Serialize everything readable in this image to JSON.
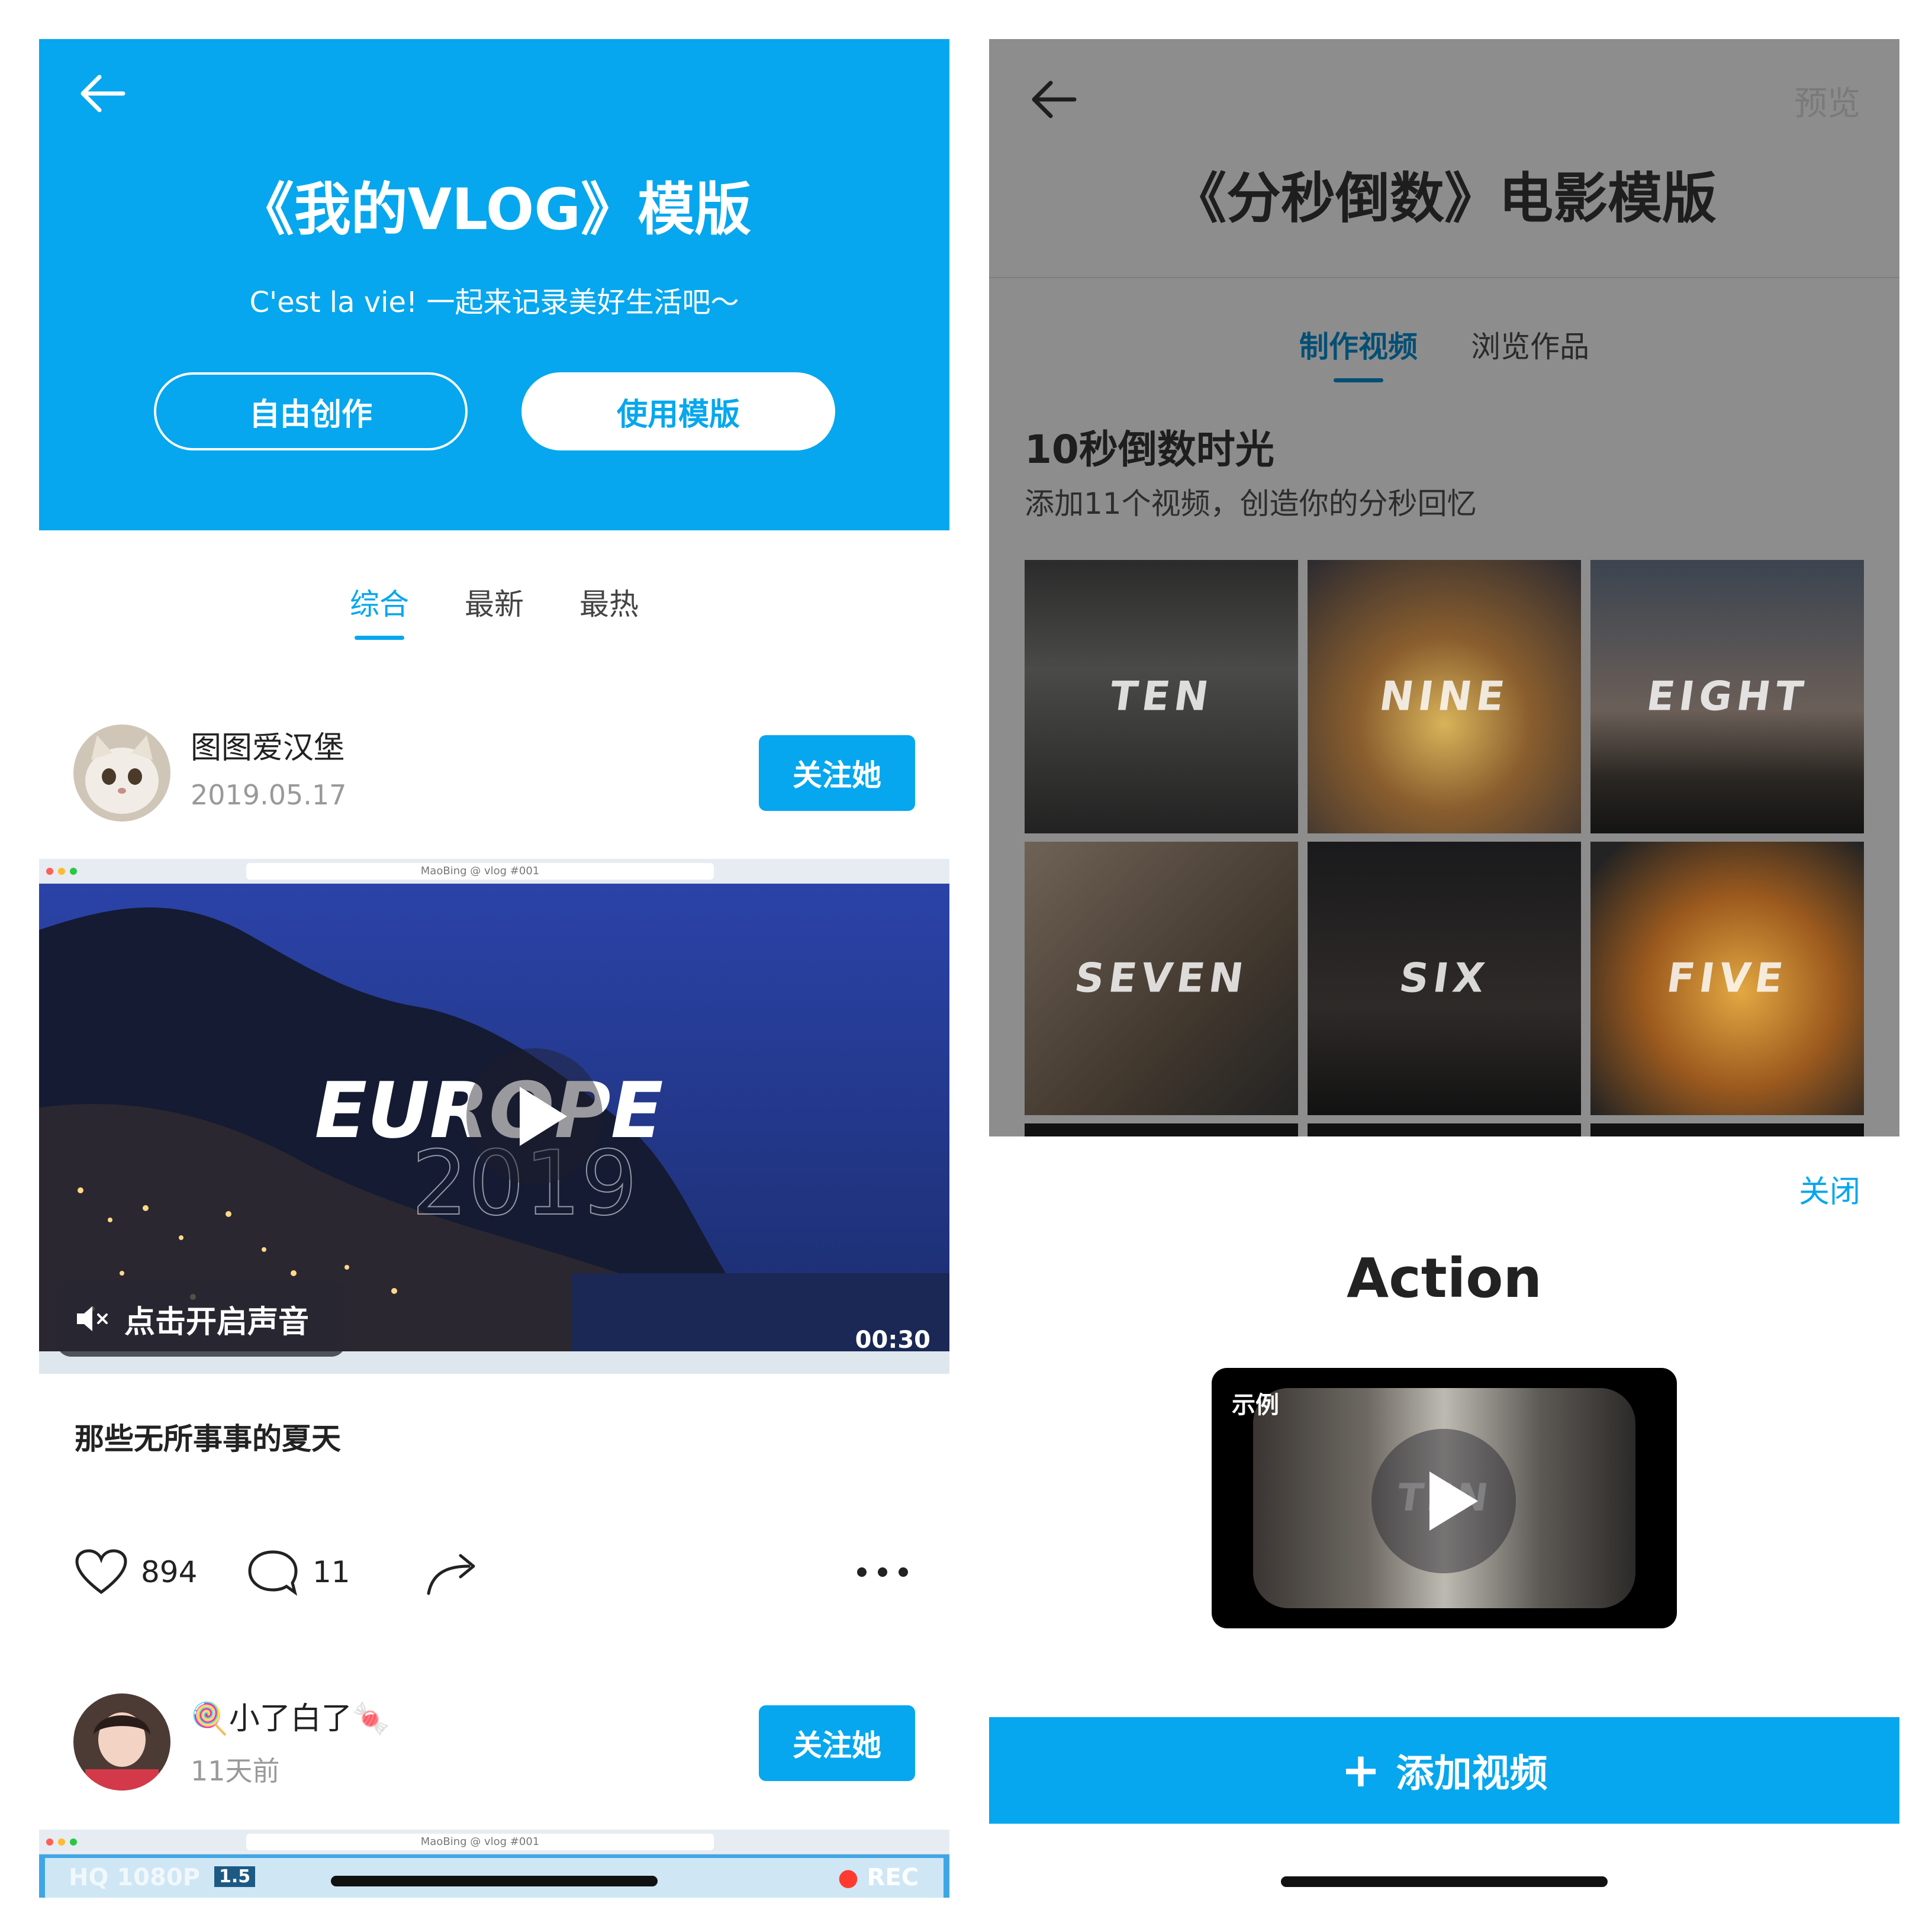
{
  "left": {
    "header": {
      "title": "《我的VLOG》模版",
      "subtitle": "C'est la vie! 一起来记录美好生活吧～",
      "buttons": {
        "free_create": "自由创作",
        "use_template": "使用模版"
      }
    },
    "tabs": [
      {
        "label": "综合",
        "active": true
      },
      {
        "label": "最新",
        "active": false
      },
      {
        "label": "最热",
        "active": false
      }
    ],
    "posts": [
      {
        "user": "图图爱汉堡",
        "time": "2019.05.17",
        "follow_label": "关注她",
        "video": {
          "browser_title": "MaoBing @ vlog #001",
          "overlay_title": "EUROPE",
          "overlay_year": "2019",
          "sound_hint": "点击开启声音",
          "duration": "00:30"
        },
        "caption": "那些无所事事的夏天",
        "likes": "894",
        "comments": "11"
      },
      {
        "user": "🍭小了白了🍬",
        "time": "11天前",
        "follow_label": "关注她",
        "video": {
          "browser_title": "MaoBing @ vlog #001",
          "hq_label": "HQ 1080P",
          "zoom_label": "1.5",
          "rec_label": "REC"
        }
      }
    ]
  },
  "right": {
    "header": {
      "title": "《分秒倒数》电影模版",
      "preview": "预览"
    },
    "tabs": [
      {
        "label": "制作视频",
        "active": true
      },
      {
        "label": "浏览作品",
        "active": false
      }
    ],
    "section": {
      "title": "10秒倒数时光",
      "desc": "添加11个视频，创造你的分秒回忆"
    },
    "tiles": [
      "TEN",
      "NINE",
      "EIGHT",
      "SEVEN",
      "SIX",
      "FIVE"
    ],
    "sheet": {
      "close": "关闭",
      "title": "Action",
      "example_label": "示例",
      "example_overlay": "TEN",
      "add_button": "添加视频",
      "add_icon": "+"
    }
  },
  "colors": {
    "accent": "#06a7ee",
    "overlay": "#8d8d8d",
    "text": "#222222"
  }
}
